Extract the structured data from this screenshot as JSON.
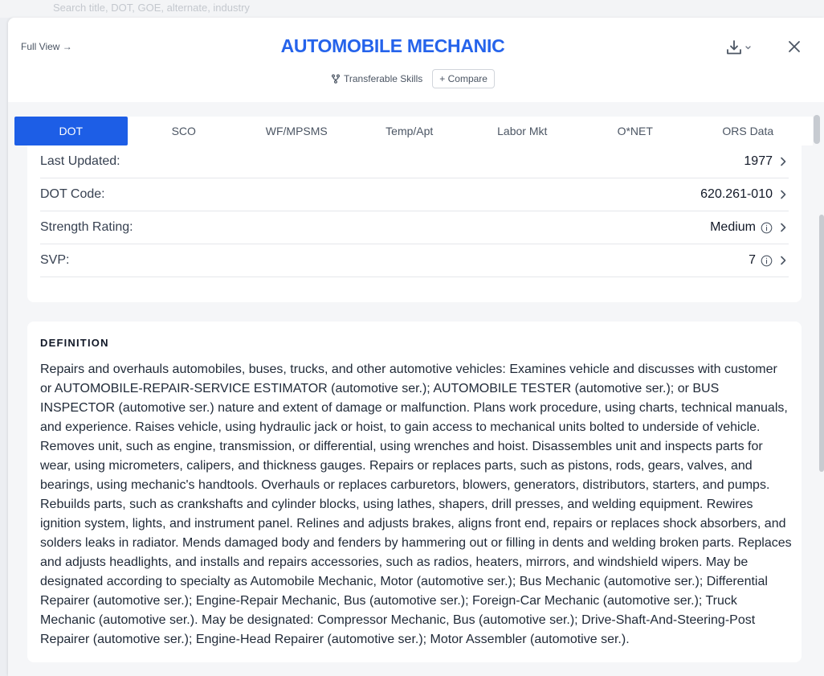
{
  "background": {
    "partial_text": "Search title, DOT, GOE, alternate, industry"
  },
  "header": {
    "full_view_label": "Full View →",
    "title": "AUTOMOBILE MECHANIC",
    "transferable_skills_label": "Transferable Skills",
    "compare_label": "+ Compare",
    "download_icon": "download-icon",
    "close_icon": "close-icon"
  },
  "tabs": [
    {
      "label": "DOT",
      "active": true
    },
    {
      "label": "SCO",
      "active": false
    },
    {
      "label": "WF/MPSMS",
      "active": false
    },
    {
      "label": "Temp/Apt",
      "active": false
    },
    {
      "label": "Labor Mkt",
      "active": false
    },
    {
      "label": "O*NET",
      "active": false
    },
    {
      "label": "ORS Data",
      "active": false
    }
  ],
  "info_rows": [
    {
      "label": "Last Updated:",
      "value": "1977",
      "info_icon": false
    },
    {
      "label": "DOT Code:",
      "value": "620.261-010",
      "info_icon": false
    },
    {
      "label": "Strength Rating:",
      "value": "Medium",
      "info_icon": true
    },
    {
      "label": "SVP:",
      "value": "7",
      "info_icon": true
    }
  ],
  "definition": {
    "heading": "DEFINITION",
    "text": "Repairs and overhauls automobiles, buses, trucks, and other automotive vehicles: Examines vehicle and discusses with customer or AUTOMOBILE-REPAIR-SERVICE ESTIMATOR (automotive ser.); AUTOMOBILE TESTER (automotive ser.); or BUS INSPECTOR (automotive ser.) nature and extent of damage or malfunction. Plans work procedure, using charts, technical manuals, and experience. Raises vehicle, using hydraulic jack or hoist, to gain access to mechanical units bolted to underside of vehicle. Removes unit, such as engine, transmission, or differential, using wrenches and hoist. Disassembles unit and inspects parts for wear, using micrometers, calipers, and thickness gauges. Repairs or replaces parts, such as pistons, rods, gears, valves, and bearings, using mechanic's handtools. Overhauls or replaces carburetors, blowers, generators, distributors, starters, and pumps. Rebuilds parts, such as crankshafts and cylinder blocks, using lathes, shapers, drill presses, and welding equipment. Rewires ignition system, lights, and instrument panel. Relines and adjusts brakes, aligns front end, repairs or replaces shock absorbers, and solders leaks in radiator. Mends damaged body and fenders by hammering out or filling in dents and welding broken parts. Replaces and adjusts headlights, and installs and repairs accessories, such as radios, heaters, mirrors, and windshield wipers. May be designated according to specialty as Automobile Mechanic, Motor (automotive ser.); Bus Mechanic (automotive ser.); Differential Repairer (automotive ser.); Engine-Repair Mechanic, Bus (automotive ser.); Foreign-Car Mechanic (automotive ser.); Truck Mechanic (automotive ser.). May be designated: Compressor Mechanic, Bus (automotive ser.); Drive-Shaft-And-Steering-Post Repairer (automotive ser.); Engine-Head Repairer (automotive ser.); Motor Assembler (automotive ser.)."
  },
  "colors": {
    "accent": "#2563eb",
    "active_tab": "#1d5ee6"
  }
}
